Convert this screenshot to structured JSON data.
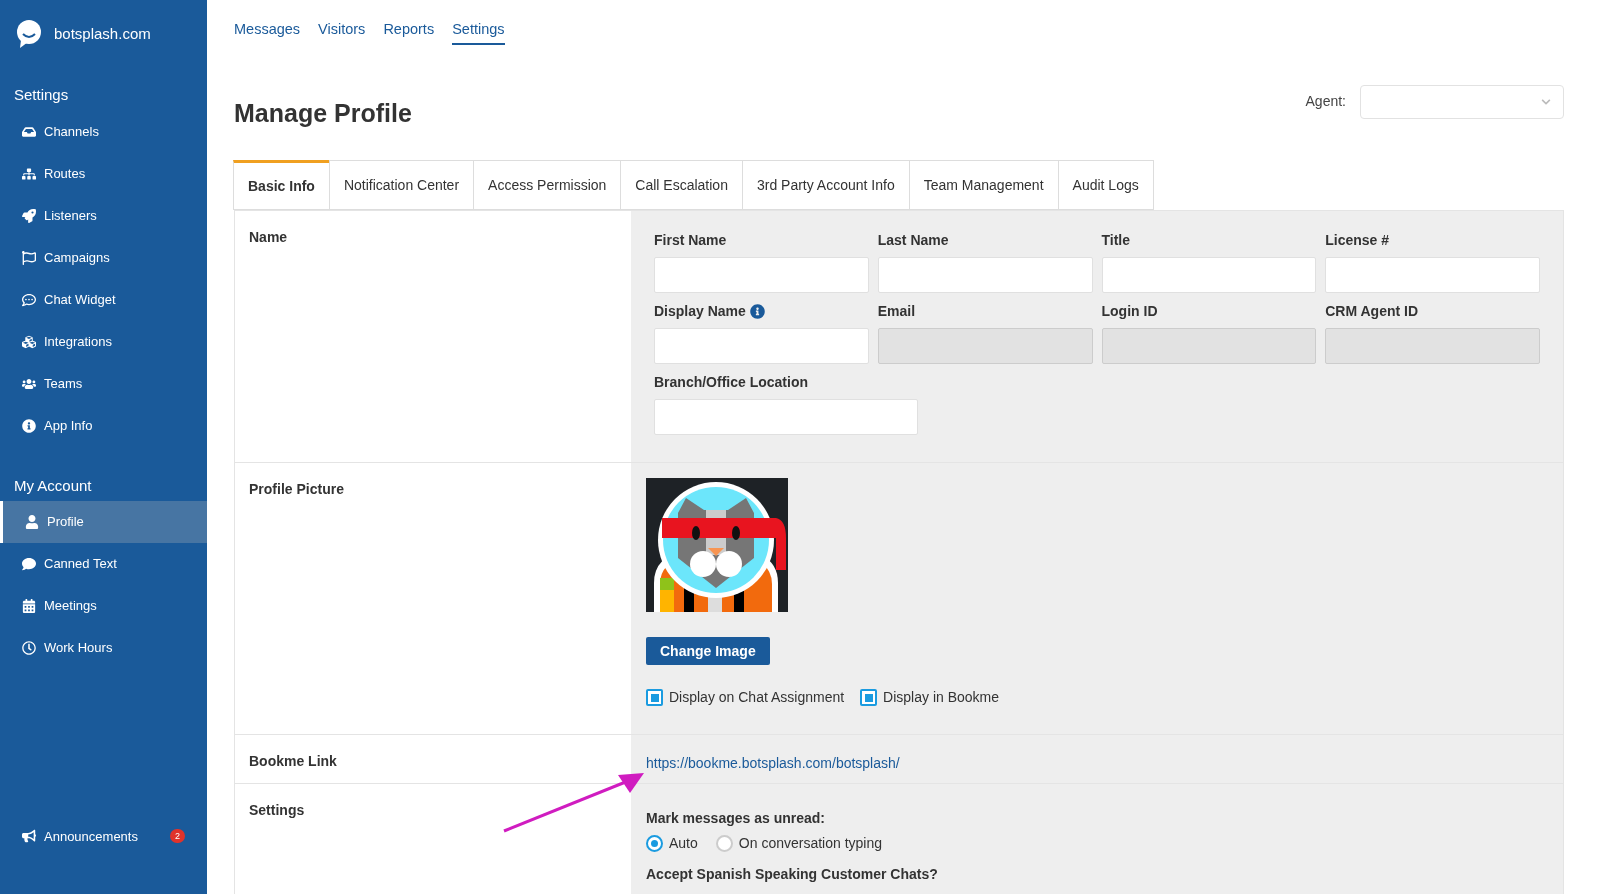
{
  "brand": {
    "name": "botsplash.com"
  },
  "sidebar": {
    "sections": [
      {
        "title": "Settings",
        "items": [
          {
            "label": "Channels",
            "selected": false
          },
          {
            "label": "Routes",
            "selected": false
          },
          {
            "label": "Listeners",
            "selected": false
          },
          {
            "label": "Campaigns",
            "selected": false
          },
          {
            "label": "Chat Widget",
            "selected": false
          },
          {
            "label": "Integrations",
            "selected": false
          },
          {
            "label": "Teams",
            "selected": false
          },
          {
            "label": "App Info",
            "selected": false
          }
        ]
      },
      {
        "title": "My Account",
        "items": [
          {
            "label": "Profile",
            "selected": true
          },
          {
            "label": "Canned Text",
            "selected": false
          },
          {
            "label": "Meetings",
            "selected": false
          },
          {
            "label": "Work Hours",
            "selected": false
          }
        ]
      }
    ],
    "footer": {
      "label": "Announcements",
      "badge": "2"
    }
  },
  "top_nav": [
    {
      "label": "Messages",
      "selected": false
    },
    {
      "label": "Visitors",
      "selected": false
    },
    {
      "label": "Reports",
      "selected": false
    },
    {
      "label": "Settings",
      "selected": true
    }
  ],
  "page_title": "Manage Profile",
  "agent_select": {
    "label": "Agent:"
  },
  "tabs": [
    {
      "label": "Basic Info",
      "selected": true
    },
    {
      "label": "Notification Center",
      "selected": false
    },
    {
      "label": "Access Permission",
      "selected": false
    },
    {
      "label": "Call Escalation",
      "selected": false
    },
    {
      "label": "3rd Party Account Info",
      "selected": false
    },
    {
      "label": "Team Management",
      "selected": false
    },
    {
      "label": "Audit Logs",
      "selected": false
    }
  ],
  "name_section": {
    "label": "Name",
    "fields": [
      {
        "label": "First Name",
        "disabled": false
      },
      {
        "label": "Last Name",
        "disabled": false
      },
      {
        "label": "Title",
        "disabled": false
      },
      {
        "label": "License #",
        "disabled": false
      },
      {
        "label": "Display Name",
        "disabled": false,
        "info": true
      },
      {
        "label": "Email",
        "disabled": true
      },
      {
        "label": "Login ID",
        "disabled": true
      },
      {
        "label": "CRM Agent ID",
        "disabled": true
      },
      {
        "label": "Branch/Office Location",
        "disabled": false,
        "wide": true
      }
    ]
  },
  "profile_picture": {
    "label": "Profile Picture",
    "button": "Change Image",
    "options": [
      {
        "label": "Display on Chat Assignment",
        "checked": true
      },
      {
        "label": "Display in Bookme",
        "checked": true
      }
    ]
  },
  "bookme": {
    "label": "Bookme Link",
    "link": "https://bookme.botsplash.com/botsplash/"
  },
  "settings": {
    "label": "Settings",
    "question": "Mark messages as unread:",
    "options": [
      {
        "label": "Auto",
        "selected": true
      },
      {
        "label": "On conversation typing",
        "selected": false
      }
    ],
    "next_question": "Accept Spanish Speaking Customer Chats?"
  }
}
